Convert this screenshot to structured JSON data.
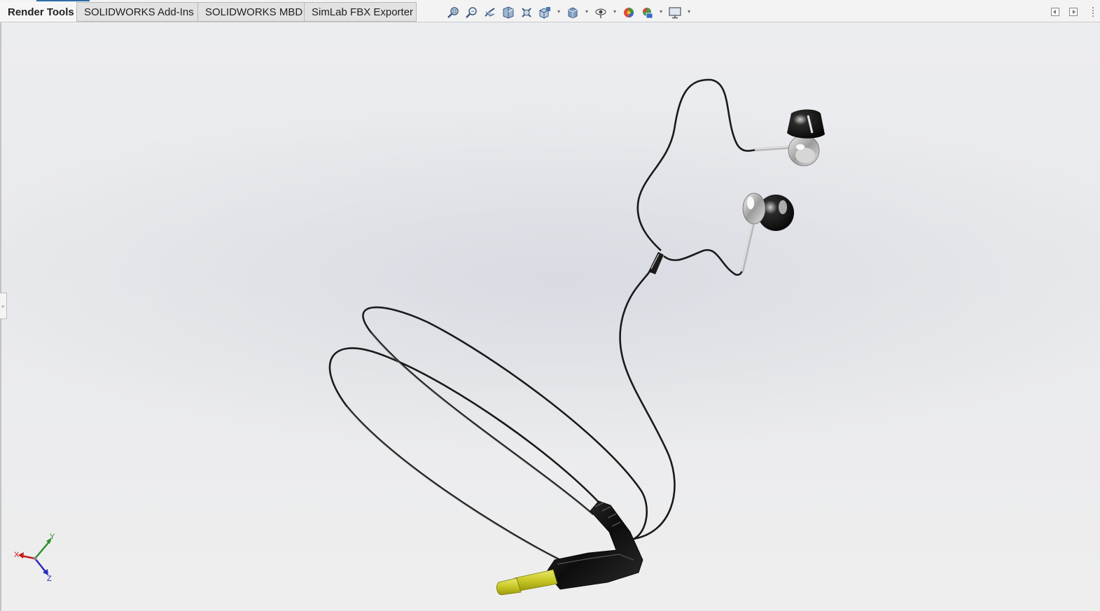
{
  "tabs": [
    {
      "label": "Render Tools",
      "active": true
    },
    {
      "label": "SOLIDWORKS Add-Ins"
    },
    {
      "label": "SOLIDWORKS MBD"
    },
    {
      "label": "SimLab FBX Exporter"
    }
  ],
  "view_toolbar": {
    "icons": [
      "zoom-to-fit-icon",
      "zoom-to-area-icon",
      "previous-view-icon",
      "section-view-icon",
      "view-setting-icon",
      "view-orientation-icon",
      "display-style-icon",
      "hide-show-items-icon",
      "edit-appearance-icon",
      "apply-scene-icon",
      "view-settings-display-icon"
    ]
  },
  "triad": {
    "x": "X",
    "y": "Y",
    "z": "Z"
  },
  "colors": {
    "accent": "#2f6ea8",
    "plug_tip": "#d4d232",
    "cable": "#1a1a1a",
    "triad_x": "#c8191a",
    "triad_y": "#2f8f2f",
    "triad_z": "#2a2ab8"
  }
}
